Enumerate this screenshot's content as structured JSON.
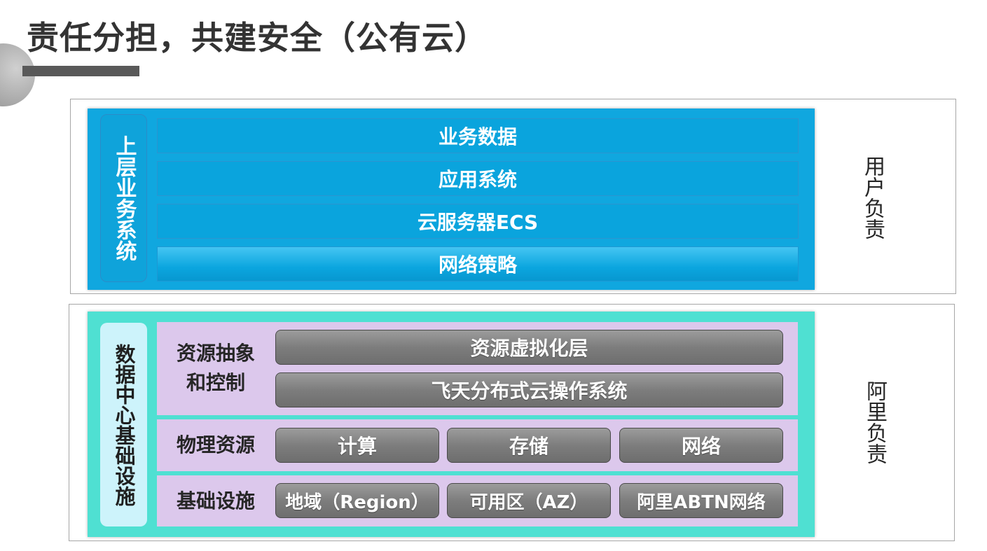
{
  "title": "责任分担，共建安全（公有云）",
  "upper": {
    "sidebar_label": "上层业务系统",
    "rows": [
      "业务数据",
      "应用系统",
      "云服务器ECS",
      "网络策略"
    ],
    "responsibility": "用户负责"
  },
  "lower": {
    "sidebar_label": "数据中心基础设施",
    "abstraction": {
      "label": "资源抽象和控制",
      "label_line1": "资源抽象",
      "label_line2": "和控制",
      "items": [
        "资源虚拟化层",
        "飞天分布式云操作系统"
      ]
    },
    "physical": {
      "label": "物理资源",
      "items": [
        "计算",
        "存储",
        "网络"
      ]
    },
    "infrastructure": {
      "label": "基础设施",
      "items": [
        "地域（Region）",
        "可用区（AZ）",
        "阿里ABTN网络"
      ]
    },
    "responsibility": "阿里负责"
  },
  "colors": {
    "upper_block": "#10a7df",
    "lower_block": "#4fe0d2",
    "lower_rows": "#dcc8ec",
    "gray_buttons": "#7d7d7d",
    "title_bar": "#595959"
  }
}
